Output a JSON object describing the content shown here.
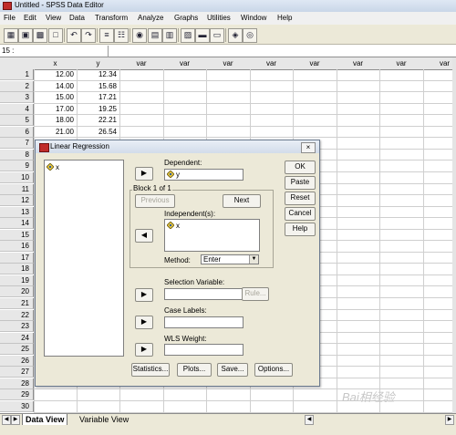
{
  "window": {
    "title": "Untitled - SPSS Data Editor"
  },
  "menu": [
    "File",
    "Edit",
    "View",
    "Data",
    "Transform",
    "Analyze",
    "Graphs",
    "Utilities",
    "Window",
    "Help"
  ],
  "cellbar": {
    "reference": "15 :"
  },
  "grid": {
    "columns": [
      "x",
      "y",
      "var",
      "var",
      "var",
      "var",
      "var",
      "var",
      "var",
      "var"
    ],
    "rows": [
      {
        "num": "1",
        "x": "12.00",
        "y": "12.34"
      },
      {
        "num": "2",
        "x": "14.00",
        "y": "15.68"
      },
      {
        "num": "3",
        "x": "15.00",
        "y": "17.21"
      },
      {
        "num": "4",
        "x": "17.00",
        "y": "19.25"
      },
      {
        "num": "5",
        "x": "18.00",
        "y": "22.21"
      },
      {
        "num": "6",
        "x": "21.00",
        "y": "26.54"
      },
      {
        "num": "7",
        "x": "",
        "y": ""
      },
      {
        "num": "8",
        "x": "",
        "y": ""
      },
      {
        "num": "9",
        "x": "",
        "y": ""
      },
      {
        "num": "10",
        "x": "",
        "y": ""
      },
      {
        "num": "11",
        "x": "",
        "y": ""
      },
      {
        "num": "12",
        "x": "",
        "y": ""
      },
      {
        "num": "13",
        "x": "",
        "y": ""
      },
      {
        "num": "14",
        "x": "",
        "y": ""
      },
      {
        "num": "15",
        "x": "",
        "y": ""
      },
      {
        "num": "16",
        "x": "",
        "y": ""
      },
      {
        "num": "17",
        "x": "",
        "y": ""
      },
      {
        "num": "18",
        "x": "",
        "y": ""
      },
      {
        "num": "19",
        "x": "",
        "y": ""
      },
      {
        "num": "20",
        "x": "",
        "y": ""
      },
      {
        "num": "21",
        "x": "",
        "y": ""
      },
      {
        "num": "22",
        "x": "",
        "y": ""
      },
      {
        "num": "23",
        "x": "",
        "y": ""
      },
      {
        "num": "24",
        "x": "",
        "y": ""
      },
      {
        "num": "25",
        "x": "",
        "y": ""
      },
      {
        "num": "26",
        "x": "",
        "y": ""
      },
      {
        "num": "27",
        "x": "",
        "y": ""
      },
      {
        "num": "28",
        "x": "",
        "y": ""
      },
      {
        "num": "29",
        "x": "",
        "y": ""
      },
      {
        "num": "30",
        "x": "",
        "y": ""
      }
    ]
  },
  "tabs": {
    "data_view": "Data View",
    "variable_view": "Variable View"
  },
  "dialog": {
    "title": "Linear Regression",
    "close": "×",
    "source_list": [
      "x"
    ],
    "dependent_label": "Dependent:",
    "dependent_value": "y",
    "block_label": "Block 1 of 1",
    "previous": "Previous",
    "next": "Next",
    "independents_label": "Independent(s):",
    "independents": [
      "x"
    ],
    "method_label": "Method:",
    "method_value": "Enter",
    "selection_label": "Selection Variable:",
    "rule": "Rule...",
    "caselabels_label": "Case Labels:",
    "wls_label": "WLS Weight:",
    "ok": "OK",
    "paste": "Paste",
    "reset": "Reset",
    "cancel": "Cancel",
    "help": "Help",
    "statistics": "Statistics...",
    "plots": "Plots...",
    "save": "Save...",
    "options": "Options..."
  },
  "watermark": "Bai相经验",
  "icons": [
    "open-icon",
    "save-icon",
    "print-icon",
    "dialog-recall-icon",
    "undo-icon",
    "redo-icon",
    "goto-case-icon",
    "variables-icon",
    "find-icon",
    "insert-case-icon",
    "insert-variable-icon",
    "split-file-icon",
    "weight-cases-icon",
    "select-cases-icon",
    "value-labels-icon",
    "use-sets-icon"
  ],
  "colors": {
    "title_bar": "#d2dcea",
    "app_icon": "#c02c2c",
    "dialog_bg": "#ece9d8"
  }
}
